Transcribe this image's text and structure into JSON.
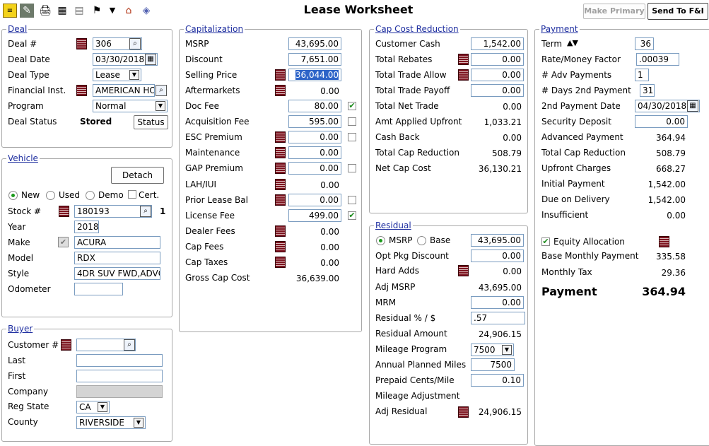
{
  "title": "Lease Worksheet",
  "header": {
    "make_primary": "Make Primary",
    "send_to_fi": "Send To F&I"
  },
  "toolbar_icons": [
    "notes-icon",
    "document-icon",
    "printer-icon",
    "calculator-icon",
    "calendar-icon",
    "flag-icon",
    "chevron-down-icon",
    "house-money-icon",
    "eraser-icon"
  ],
  "deal": {
    "title": "Deal",
    "deal_no_label": "Deal #",
    "deal_no": "306",
    "deal_date_label": "Deal Date",
    "deal_date": "03/30/2018",
    "deal_type_label": "Deal Type",
    "deal_type": "Lease",
    "fin_inst_label": "Financial Inst.",
    "fin_inst": "AMERICAN HON",
    "program_label": "Program",
    "program": "Normal",
    "status_label": "Deal Status",
    "status": "Stored",
    "status_btn": "Status"
  },
  "vehicle": {
    "title": "Vehicle",
    "detach": "Detach",
    "radio_new": "New",
    "radio_used": "Used",
    "radio_demo": "Demo",
    "cert": "Cert.",
    "stock_label": "Stock #",
    "stock": "180193",
    "stock_count": "1",
    "year_label": "Year",
    "year": "2018",
    "make_label": "Make",
    "make": "ACURA",
    "model_label": "Model",
    "model": "RDX",
    "style_label": "Style",
    "style": "4DR SUV FWD,ADVC",
    "odometer_label": "Odometer",
    "odometer": ""
  },
  "buyer": {
    "title": "Buyer",
    "customer_label": "Customer #",
    "customer": "",
    "last_label": "Last",
    "last": "",
    "first_label": "First",
    "first": "",
    "company_label": "Company",
    "company": "",
    "reg_state_label": "Reg State",
    "reg_state": "CA",
    "county_label": "County",
    "county": "RIVERSIDE"
  },
  "capitalization": {
    "title": "Capitalization",
    "msrp_label": "MSRP",
    "msrp": "43,695.00",
    "discount_label": "Discount",
    "discount": "7,651.00",
    "selling_label": "Selling Price",
    "selling": "36,044.00",
    "aftermarkets_label": "Aftermarkets",
    "aftermarkets": "0.00",
    "doc_fee_label": "Doc Fee",
    "doc_fee": "80.00",
    "acq_fee_label": "Acquisition Fee",
    "acq_fee": "595.00",
    "esc_label": "ESC Premium",
    "esc": "0.00",
    "maint_label": "Maintenance",
    "maint": "0.00",
    "gap_label": "GAP Premium",
    "gap": "0.00",
    "lah_label": "LAH/IUI",
    "lah": "0.00",
    "prior_label": "Prior Lease Bal",
    "prior": "0.00",
    "license_label": "License Fee",
    "license": "499.00",
    "dealer_label": "Dealer Fees",
    "dealer": "0.00",
    "capfees_label": "Cap Fees",
    "capfees": "0.00",
    "captaxes_label": "Cap Taxes",
    "captaxes": "0.00",
    "gross_label": "Gross Cap Cost",
    "gross": "36,639.00"
  },
  "capcost": {
    "title": "Cap Cost Reduction",
    "cust_cash_label": "Customer Cash",
    "cust_cash": "1,542.00",
    "rebates_label": "Total Rebates",
    "rebates": "0.00",
    "trade_allow_label": "Total Trade Allow",
    "trade_allow": "0.00",
    "trade_payoff_label": "Total Trade Payoff",
    "trade_payoff": "0.00",
    "net_trade_label": "Total Net Trade",
    "net_trade": "0.00",
    "upfront_label": "Amt Applied Upfront",
    "upfront": "1,033.21",
    "cashback_label": "Cash Back",
    "cashback": "0.00",
    "total_red_label": "Total Cap Reduction",
    "total_red": "508.79",
    "net_cap_label": "Net Cap Cost",
    "net_cap": "36,130.21"
  },
  "residual": {
    "title": "Residual",
    "msrp_radio": "MSRP",
    "base_radio": "Base",
    "msrp": "43,695.00",
    "opt_label": "Opt Pkg Discount",
    "opt": "0.00",
    "hard_label": "Hard Adds",
    "hard": "0.00",
    "adj_msrp_label": "Adj MSRP",
    "adj_msrp": "43,695.00",
    "mrm_label": "MRM",
    "mrm": "0.00",
    "pct_label": "Residual % / $",
    "pct": ".57",
    "amount_label": "Residual Amount",
    "amount": "24,906.15",
    "mileage_prog_label": "Mileage Program",
    "mileage_prog": "7500",
    "annual_label": "Annual Planned Miles",
    "annual": "7500",
    "prepaid_label": "Prepaid Cents/Mile",
    "prepaid": "0.10",
    "mileage_adj_label": "Mileage Adjustment",
    "adj_res_label": "Adj Residual",
    "adj_res": "24,906.15"
  },
  "payment": {
    "title": "Payment",
    "term_label": "Term",
    "term": "36",
    "rate_label": "Rate/Money Factor",
    "rate": ".00039",
    "adv_label": "# Adv Payments",
    "adv": "1",
    "days_label": "# Days 2nd Payment",
    "days": "31",
    "date2_label": "2nd Payment Date",
    "date2": "04/30/2018",
    "sec_label": "Security Deposit",
    "sec": "0.00",
    "advpay_label": "Advanced Payment",
    "advpay": "364.94",
    "totred_label": "Total Cap Reduction",
    "totred": "508.79",
    "upfront_label": "Upfront Charges",
    "upfront": "668.27",
    "initial_label": "Initial Payment",
    "initial": "1,542.00",
    "due_label": "Due on Delivery",
    "due": "1,542.00",
    "insuff_label": "Insufficient",
    "insuff": "0.00",
    "equity_label": "Equity Allocation",
    "base_label": "Base Monthly Payment",
    "base": "335.58",
    "tax_label": "Monthly Tax",
    "tax": "29.36",
    "payment_label": "Payment",
    "payment": "364.94"
  }
}
